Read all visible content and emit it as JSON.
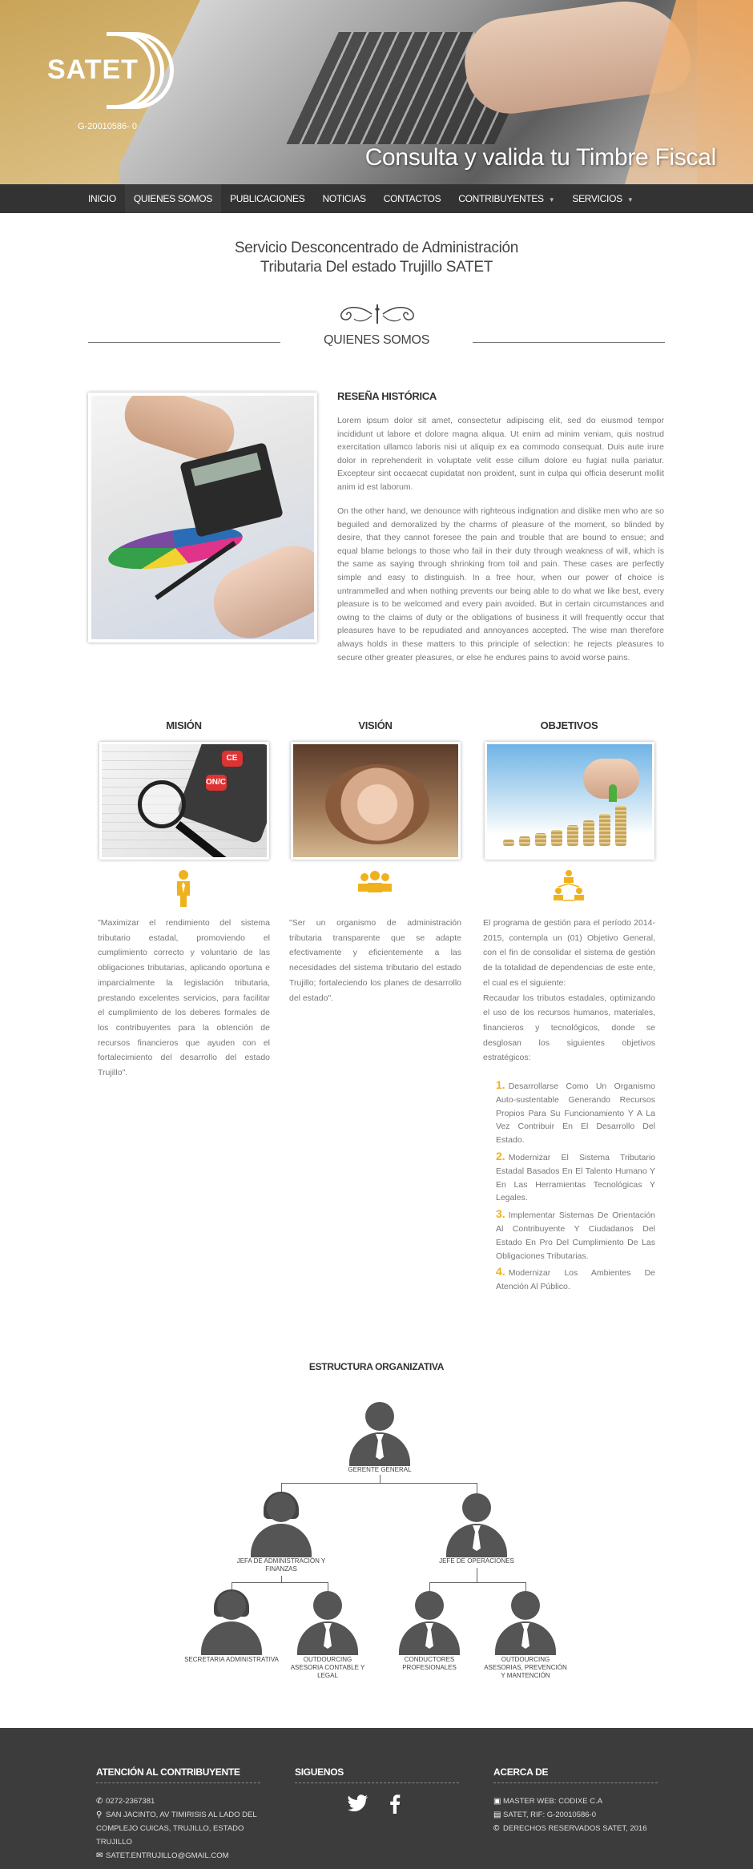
{
  "hero": {
    "logo_text": "SATET",
    "logo_rif": "G-20010586- 0",
    "title": "Consulta y valida tu Timbre Fiscal"
  },
  "nav": {
    "items": [
      {
        "label": "INICIO"
      },
      {
        "label": "QUIENES SOMOS"
      },
      {
        "label": "PUBLICACIONES"
      },
      {
        "label": "NOTICIAS"
      },
      {
        "label": "CONTACTOS"
      },
      {
        "label": "CONTRIBUYENTES"
      },
      {
        "label": "SERVICIOS"
      }
    ]
  },
  "intro": {
    "title_line1": "Servicio Desconcentrado de Administración",
    "title_line2": "Tributaria Del estado Trujillo SATET",
    "section": "QUIENES SOMOS"
  },
  "resena": {
    "title": "RESEÑA HISTÓRICA",
    "p1": "Lorem ipsum dolor sit amet, consectetur adipiscing elit, sed do eiusmod tempor incididunt ut labore et dolore magna aliqua. Ut enim ad minim veniam, quis nostrud exercitation ullamco laboris nisi ut aliquip ex ea commodo consequat. Duis aute irure dolor in reprehenderit in voluptate velit esse cillum dolore eu fugiat nulla pariatur. Excepteur sint occaecat cupidatat non proident, sunt in culpa qui officia deserunt mollit anim id est laborum.",
    "p2": "On the other hand, we denounce with righteous indignation and dislike men who are so beguiled and demoralized by the charms of pleasure of the moment, so blinded by desire, that they cannot foresee the pain and trouble that are bound to ensue; and equal blame belongs to those who fail in their duty through weakness of will, which is the same as saying through shrinking from toil and pain. These cases are perfectly simple and easy to distinguish. In a free hour, when our power of choice is untrammelled and when nothing prevents our being able to do what we like best, every pleasure is to be welcomed and every pain avoided. But in certain circumstances and owing to the claims of duty or the obligations of business it will frequently occur that pleasures have to be repudiated and annoyances accepted. The wise man therefore always holds in these matters to this principle of selection: he rejects pleasures to secure other greater pleasures, or else he endures pains to avoid worse pains."
  },
  "mision": {
    "title": "MISIÓN",
    "text": "\"Maximizar el rendimiento del sistema tributario estadal, promoviendo el cumplimiento correcto y voluntario de las obligaciones tributarias, aplicando oportuna e imparcialmente la legislación tributaria, prestando excelentes servicios, para facilitar el cumplimiento de los deberes formales de los contribuyentes para la obtención de recursos financieros que ayuden con el fortalecimiento del desarrollo del estado Trujillo\".",
    "btn1": "CE",
    "btn2": "ON/C"
  },
  "vision": {
    "title": "VISIÓN",
    "text": "\"Ser un organismo de administración tributaria transparente que se adapte efectivamente y eficientemente a las necesidades del sistema tributario del estado Trujillo; fortaleciendo los planes de desarrollo del estado\"."
  },
  "objetivos": {
    "title": "OBJETIVOS",
    "text1": "El programa de gestión para el período 2014-2015, contempla un (01) Objetivo General, con el fin de consolidar el sistema de gestión de la totalidad de dependencias de este ente, el cual es el siguiente:",
    "text2": "Recaudar los tributos estadales, optimizando el uso de los recursos humanos, materiales, financieros y tecnológicos, donde se desglosan los siguientes objetivos estratégicos:",
    "items": [
      {
        "num": "1.",
        "text": "Desarrollarse Como Un Organismo Auto-sustentable Generando Recursos Propios Para Su Funcionamiento Y A La Vez Contribuir En El Desarrollo Del Estado."
      },
      {
        "num": "2.",
        "text": "Modernizar El Sistema Tributario Estadal Basados En El Talento Humano Y En Las Herramientas Tecnológicas Y Legales."
      },
      {
        "num": "3.",
        "text": "Implementar Sistemas De Orientación Al Contribuyente Y Ciudadanos Del Estado En Pro Del Cumplimiento De Las Obligaciones Tributarias."
      },
      {
        "num": "4.",
        "text": "Modernizar Los Ambientes De Atención Al Público."
      }
    ]
  },
  "org": {
    "title": "ESTRUCTURA ORGANIZATIVA",
    "gerente": "GERENTE GENERAL",
    "jefa_adm": "JEFA DE ADMINISTRACIÓN Y FINANZAS",
    "jefe_ope": "JEFE DE OPERACIONES",
    "secretaria": "SECRETARIA ADMINISTRATIVA",
    "outsourcing1": "OUTDOURCING ASESORIA CONTABLE Y LEGAL",
    "conductores": "CONDUCTORES PROFESIONALES",
    "outsourcing2": "OUTDOURCING ASESORIAS, PREVENCIÓN Y MANTENCIÓN"
  },
  "footer": {
    "atencion_title": "ATENCIÓN AL CONTRIBUYENTE",
    "phone": "0272-2367381",
    "address1": "SAN JACINTO, AV TIMIRISIS AL LADO DEL",
    "address2": "COMPLEJO CUICAS, TRUJILLO, ESTADO TRUJILLO",
    "email": "SATET.ENTRUJILLO@GMAIL.COM",
    "siguenos_title": "SIGUENOS",
    "acerca_title": "ACERCA DE",
    "master": "MASTER WEB: CODIXE C.A",
    "rif": "SATET, RIF: G-20010586-0",
    "copyright": "DERECHOS RESERVADOS SATET, 2016"
  }
}
